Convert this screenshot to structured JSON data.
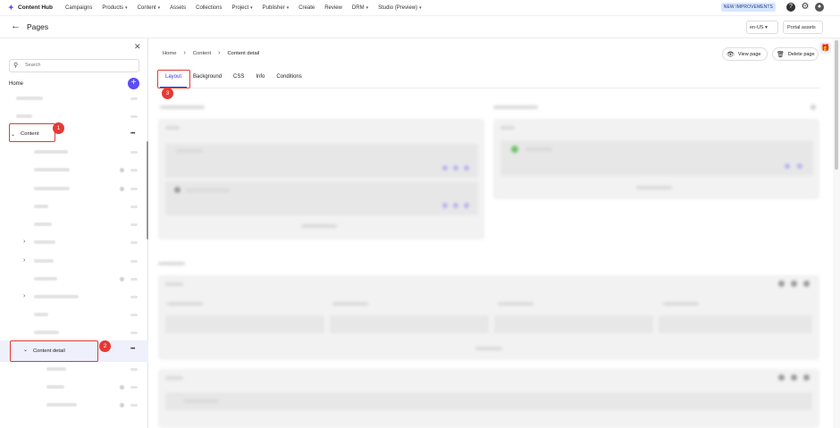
{
  "topnav": {
    "brand": "Content Hub",
    "items": [
      {
        "label": "Campaigns",
        "dropdown": false
      },
      {
        "label": "Products",
        "dropdown": true
      },
      {
        "label": "Content",
        "dropdown": true
      },
      {
        "label": "Assets",
        "dropdown": false
      },
      {
        "label": "Collections",
        "dropdown": false
      },
      {
        "label": "Project",
        "dropdown": true
      },
      {
        "label": "Publisher",
        "dropdown": true
      },
      {
        "label": "Create",
        "dropdown": false
      },
      {
        "label": "Review",
        "dropdown": false
      },
      {
        "label": "DRM",
        "dropdown": true
      },
      {
        "label": "Studio (Preview)",
        "dropdown": true
      }
    ],
    "improvements_badge": "NEW IMPROVEMENTS",
    "icons": [
      "help-icon",
      "gear-icon",
      "user-avatar-icon"
    ]
  },
  "header": {
    "title": "Pages",
    "language": "en-US",
    "portal_assets": "Portal assets"
  },
  "sidebar": {
    "search_placeholder": "Search",
    "home_label": "Home",
    "content_label": "Content",
    "content_detail_label": "Content detail"
  },
  "main": {
    "breadcrumb": [
      "Home",
      "Content",
      "Content detail"
    ],
    "view_page": "View page",
    "delete_page": "Delete page",
    "tabs": [
      {
        "label": "Layout",
        "active": true
      },
      {
        "label": "Background",
        "active": false
      },
      {
        "label": "CSS",
        "active": false
      },
      {
        "label": "Info",
        "active": false
      },
      {
        "label": "Conditions",
        "active": false
      }
    ]
  },
  "annotations": [
    "1",
    "2",
    "3"
  ],
  "colors": {
    "accent": "#5b4cf5",
    "active_tab": "#3d3fd1",
    "annotation": "#e53935"
  }
}
